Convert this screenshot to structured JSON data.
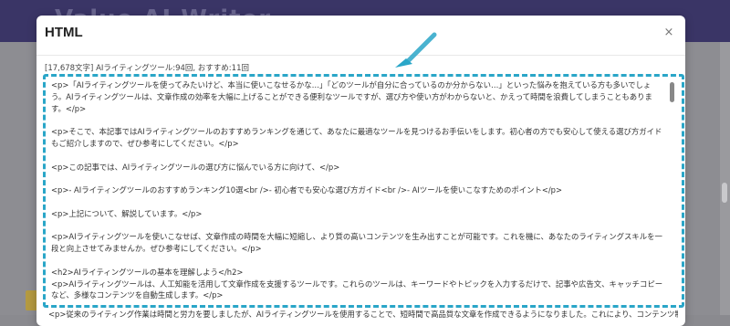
{
  "app": {
    "logo_text": "Value AI Writer"
  },
  "modal": {
    "title": "HTML",
    "close_label": "×",
    "meta": "[17,678文字] AIライティングツール:94回, おすすめ:11回"
  },
  "content_lines": [
    "<p>「AIライティングツールを使ってみたいけど、本当に使いこなせるかな…」「どのツールが自分に合っているのか分からない…」といった悩みを抱えている方も多いでしょう。AIライティングツールは、文章作成の効率を大幅に上げることができる便利なツールですが、選び方や使い方がわからないと、かえって時間を浪費してしまうこともあります。</p>",
    "",
    "<p>そこで、本記事ではAIライティングツールのおすすめランキングを通じて、あなたに最適なツールを見つけるお手伝いをします。初心者の方でも安心して使える選び方ガイドもご紹介しますので、ぜひ参考にしてください。</p>",
    "",
    "<p>この記事では、AIライティングツールの選び方に悩んでいる方に向けて、</p>",
    "",
    "<p>- AIライティングツールのおすすめランキング10選<br />- 初心者でも安心な選び方ガイド<br />- AIツールを使いこなすためのポイント</p>",
    "",
    "<p>上記について、解説しています。</p>",
    "",
    "<p>AIライティングツールを使いこなせば、文章作成の時間を大幅に短縮し、より質の高いコンテンツを生み出すことが可能です。これを機に、あなたのライティングスキルを一段と向上させてみませんか。ぜひ参考にしてください。</p>",
    "",
    "<h2>AIライティングツールの基本を理解しよう</h2>",
    "<p>AIライティングツールは、人工知能を活用して文章作成を支援するツールです。これらのツールは、キーワードやトピックを入力するだけで、記事や広告文、キャッチコピーなど、多様なコンテンツを自動生成します。</p>"
  ],
  "below_line": "<p>従来のライティング作業は時間と労力を要しましたが、AIライティングツールを使用することで、短時間で高品質な文章を作成できるようになりました。これにより、コンテンツ制作の効率が飛躍"
}
